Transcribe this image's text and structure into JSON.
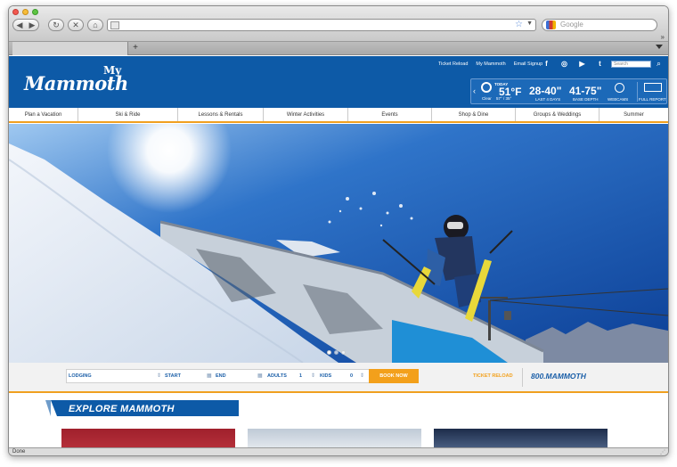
{
  "browser": {
    "nav_back": "◀",
    "nav_forward": "▶",
    "reload": "↻",
    "stop": "✕",
    "home": "⌂",
    "search_placeholder": "Google",
    "add_tab": "+",
    "overflow": "»",
    "status": "Done"
  },
  "site": {
    "logo": "Mammoth",
    "logo_mark": "My",
    "top_links": [
      "Ticket Reload",
      "My Mammoth",
      "Email Signup"
    ],
    "socials": [
      "f",
      "◎",
      "▶",
      "t"
    ],
    "search_placeholder": "Search",
    "weather": {
      "today_label": "TODAY",
      "temp": "51°F",
      "condition": "Clear",
      "range": "57° / 35°",
      "snow": "28-40\"",
      "snow_label": "LAST 4 DAYS",
      "base": "41-75\"",
      "base_label": "BASE DEPTH",
      "webcams_label": "WEBCAMS",
      "report_label": "FULL REPORT"
    },
    "nav": [
      "Plan a Vacation",
      "Ski & Ride",
      "Lessons & Rentals",
      "Winter Activities",
      "Events",
      "Shop & Dine",
      "Groups & Weddings",
      "Summer"
    ],
    "booking": {
      "lodging": "LODGING",
      "start": "START",
      "end": "END",
      "adults": "ADULTS",
      "adults_value": "1",
      "kids": "KIDS",
      "kids_value": "0",
      "book_now": "BOOK NOW",
      "ticket_reload": "TICKET RELOAD",
      "phone": "800.MAMMOTH"
    },
    "explore_title": "EXPLORE MAMMOTH",
    "slide_count": 3,
    "active_slide": 1
  },
  "colors": {
    "brand_blue": "#0d5aa7",
    "accent_orange": "#f3a01b"
  }
}
